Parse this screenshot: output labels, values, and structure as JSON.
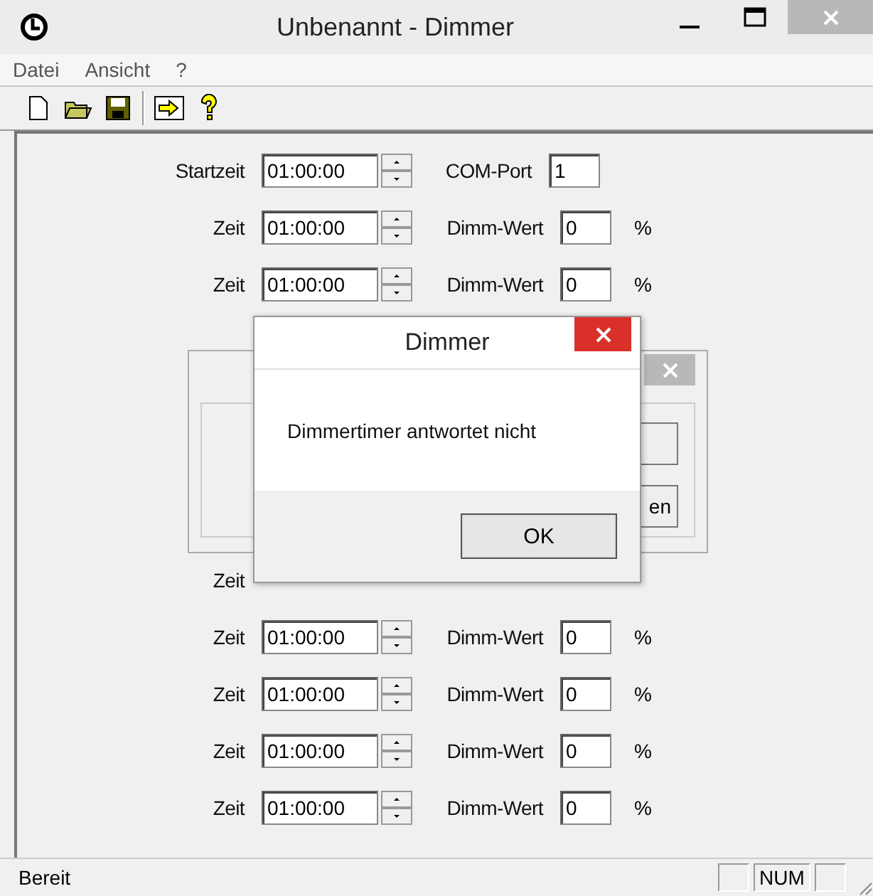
{
  "window": {
    "title": "Unbenannt - Dimmer"
  },
  "menu": [
    "Datei",
    "Ansicht",
    "?"
  ],
  "toolbar": [
    {
      "kind": "new"
    },
    {
      "kind": "open"
    },
    {
      "kind": "save"
    },
    {
      "kind": "separator"
    },
    {
      "kind": "arrow"
    },
    {
      "kind": "help"
    }
  ],
  "start_row": {
    "label": "Startzeit",
    "time": "01:00:00",
    "port_label": "COM-Port",
    "port": "1"
  },
  "rows_top": [
    {
      "label": "Zeit",
      "time": "01:00:00",
      "value_label": "Dimm-Wert",
      "value": "0",
      "unit": "%"
    },
    {
      "label": "Zeit",
      "time": "01:00:00",
      "value_label": "Dimm-Wert",
      "value": "0",
      "unit": "%"
    }
  ],
  "rows_bottom": [
    {
      "label": "Zeit"
    },
    {
      "label": "Zeit",
      "time": "01:00:00",
      "value_label": "Dimm-Wert",
      "value": "0",
      "unit": "%"
    },
    {
      "label": "Zeit",
      "time": "01:00:00",
      "value_label": "Dimm-Wert",
      "value": "0",
      "unit": "%"
    },
    {
      "label": "Zeit",
      "time": "01:00:00",
      "value_label": "Dimm-Wert",
      "value": "0",
      "unit": "%"
    },
    {
      "label": "Zeit",
      "time": "01:00:00",
      "value_label": "Dimm-Wert",
      "value": "0",
      "unit": "%"
    }
  ],
  "background_dialog": {
    "button_label": "en"
  },
  "message_box": {
    "title": "Dimmer",
    "message": "Dimmertimer antwortet nicht",
    "button": "OK"
  },
  "status_bar": {
    "text": "Bereit",
    "indicator": "NUM"
  }
}
